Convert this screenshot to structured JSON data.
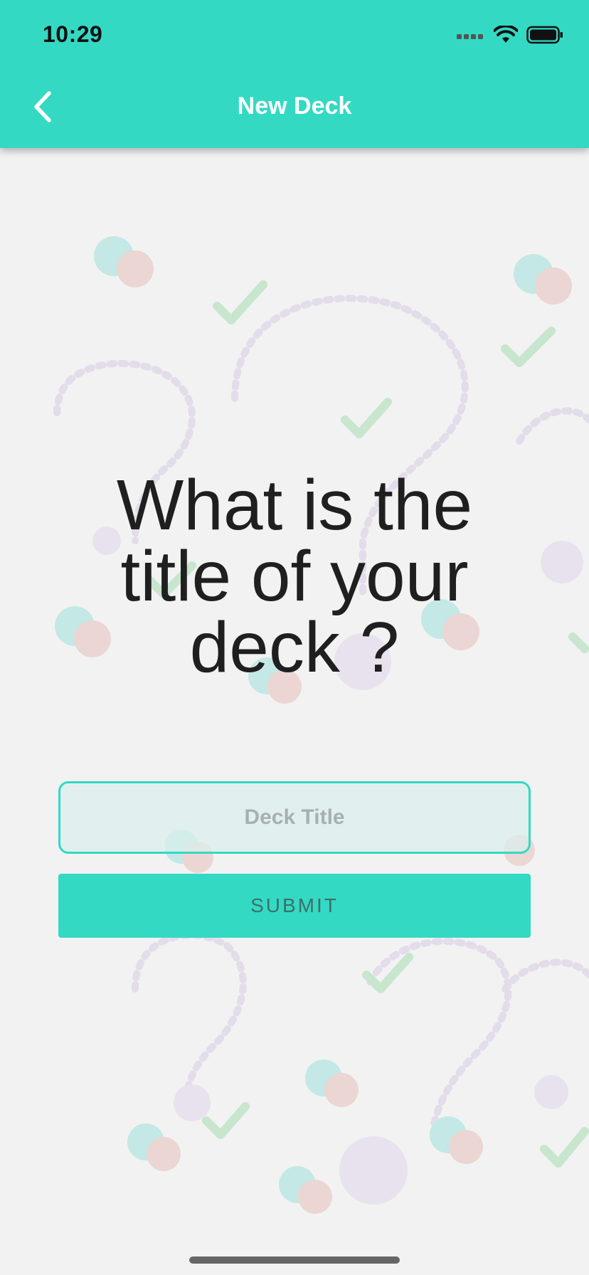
{
  "status_bar": {
    "time": "10:29",
    "icons": [
      "signal-icon",
      "wifi-icon",
      "battery-icon"
    ]
  },
  "nav": {
    "title": "New Deck",
    "back_icon": "chevron-left-icon"
  },
  "main": {
    "prompt": "What is the title of your deck ?",
    "input": {
      "placeholder": "Deck Title",
      "value": ""
    },
    "submit_label": "SUBMIT"
  },
  "colors": {
    "accent": "#33d9c3",
    "background": "#f2f2f2",
    "text": "#1f1f1f"
  }
}
